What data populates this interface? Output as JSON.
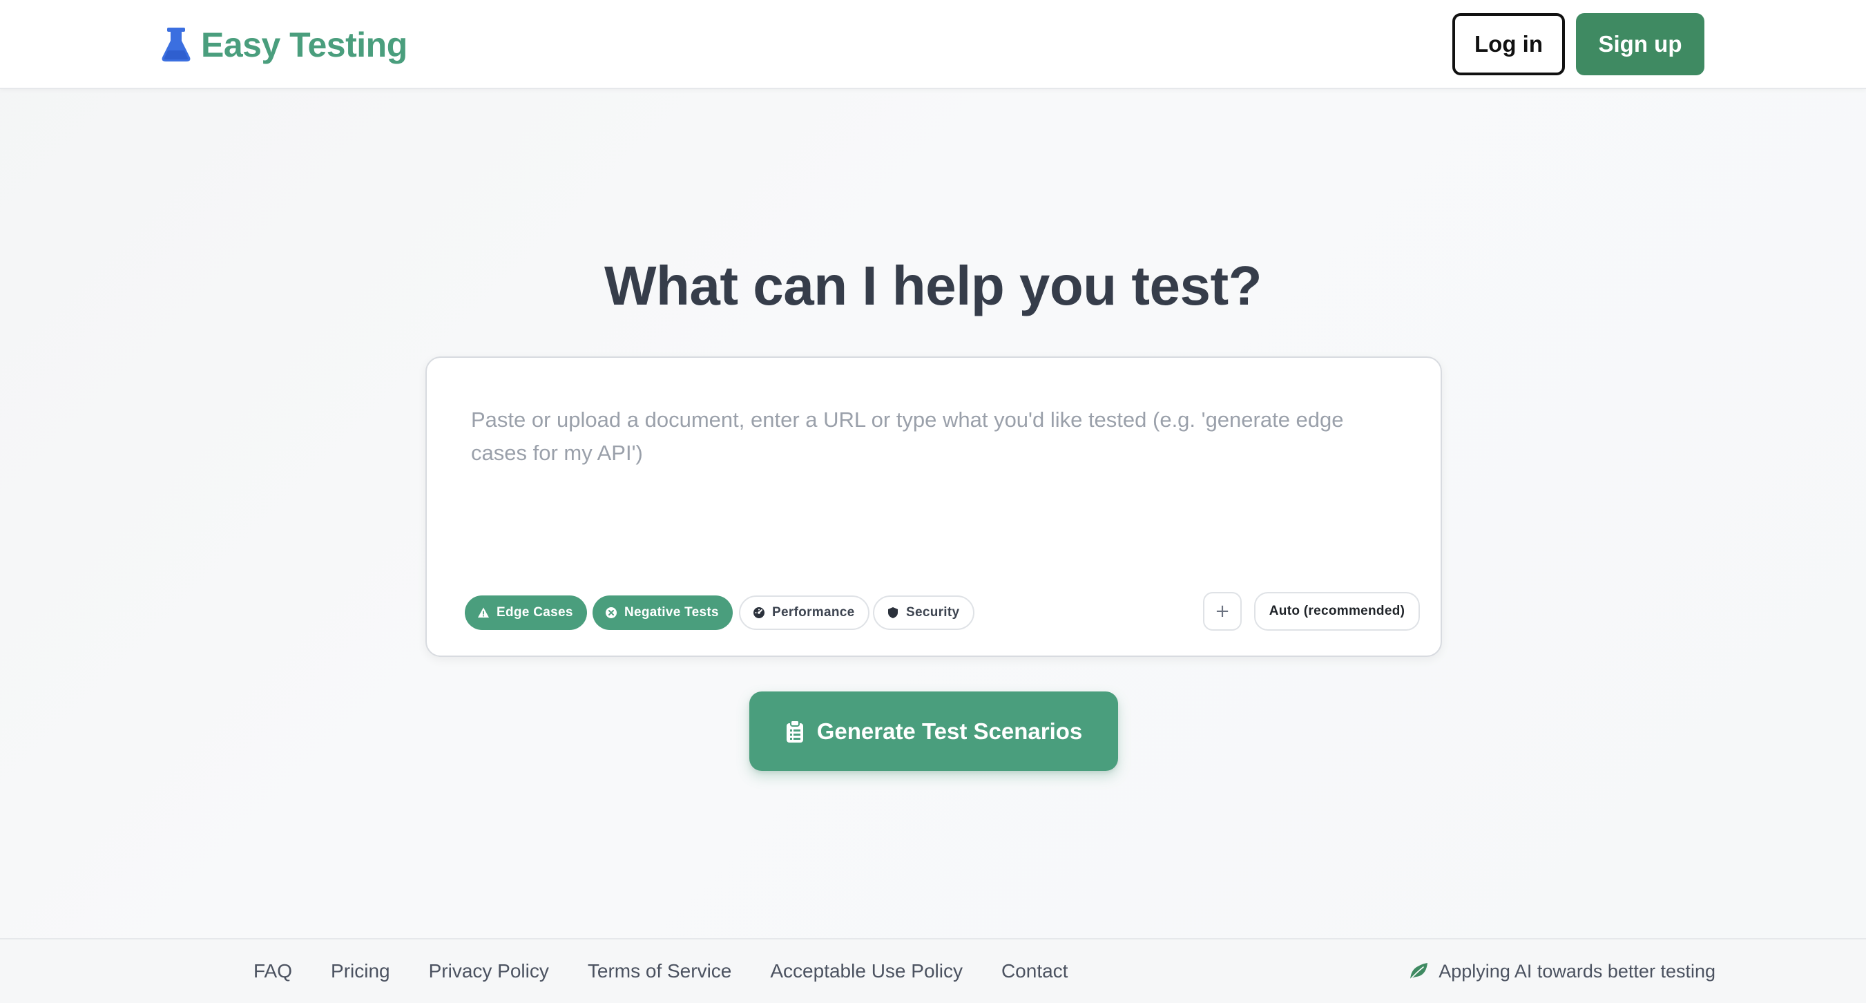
{
  "brand": {
    "name": "Easy Testing",
    "icon": "flask-icon",
    "icon_color": "#3b6fe0",
    "color": "#4a9e7d"
  },
  "header": {
    "login_label": "Log in",
    "signup_label": "Sign up"
  },
  "hero": {
    "title": "What can I help you test?"
  },
  "prompt": {
    "value": "",
    "placeholder": "Paste or upload a document, enter a URL or type what you'd like tested (e.g. 'generate edge cases for my API')"
  },
  "chips": [
    {
      "label": "Edge Cases",
      "icon": "warning-triangle-icon",
      "active": true
    },
    {
      "label": "Negative Tests",
      "icon": "x-circle-icon",
      "active": true
    },
    {
      "label": "Performance",
      "icon": "gauge-icon",
      "active": false
    },
    {
      "label": "Security",
      "icon": "shield-icon",
      "active": false
    }
  ],
  "attach": {
    "label": "+",
    "icon": "plus-icon"
  },
  "model": {
    "selected": "Auto (recommended)"
  },
  "generate": {
    "label": "Generate Test Scenarios",
    "icon": "clipboard-icon"
  },
  "footer": {
    "links": [
      "FAQ",
      "Pricing",
      "Privacy Policy",
      "Terms of Service",
      "Acceptable Use Policy",
      "Contact"
    ],
    "tagline": "Applying AI towards better testing",
    "tagline_icon": "leaf-icon"
  },
  "colors": {
    "accent": "#4a9e7d",
    "accent_dark": "#3f8a62",
    "title": "#363d4a"
  }
}
